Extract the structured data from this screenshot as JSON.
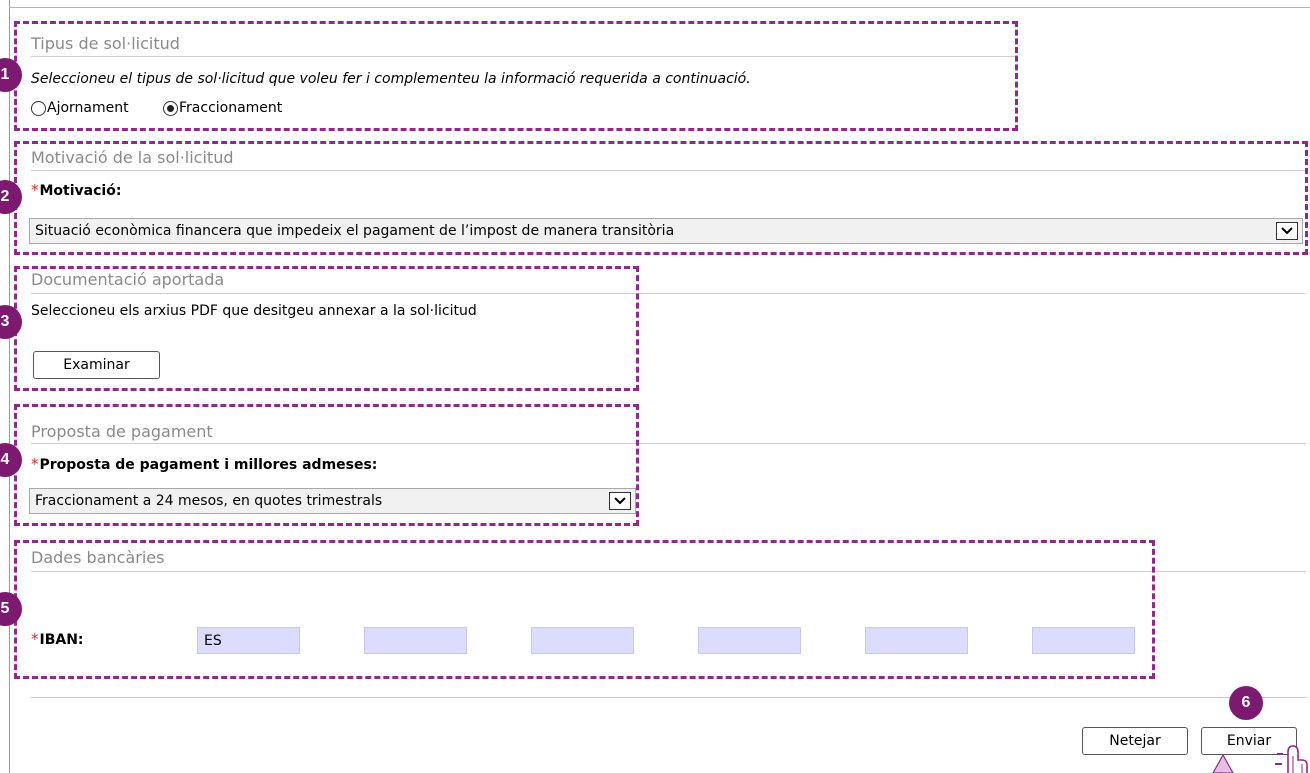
{
  "sections": {
    "request_type": {
      "step": "1",
      "legend": "Tipus de sol·licitud",
      "instruction": "Seleccioneu el tipus de sol·licitud que voleu fer i complementeu la informació requerida a continuació.",
      "options": [
        {
          "label": "Ajornament",
          "selected": false
        },
        {
          "label": "Fraccionament",
          "selected": true
        }
      ]
    },
    "motivation": {
      "step": "2",
      "legend": "Motivació de la sol·licitud",
      "required_mark": "*",
      "label": "Motivació:",
      "selected_value": "Situació econòmica financera que impedeix el pagament de l’impost de manera transitòria"
    },
    "documents": {
      "step": "3",
      "legend": "Documentació aportada",
      "instruction": "Seleccioneu els arxius PDF que desitgeu annexar a la sol·licitud",
      "browse_label": "Examinar"
    },
    "payment_proposal": {
      "step": "4",
      "legend": "Proposta de pagament",
      "required_mark": "*",
      "label": "Proposta de pagament i millores admeses:",
      "selected_value": "Fraccionament a 24 mesos, en quotes trimestrals"
    },
    "bank": {
      "step": "5",
      "legend": "Dades bancàries",
      "required_mark": "*",
      "label": "IBAN:",
      "iban_fields": [
        "ES",
        "",
        "",
        "",
        "",
        ""
      ]
    }
  },
  "actions": {
    "step": "6",
    "clear_label": "Netejar",
    "submit_label": "Enviar"
  },
  "colors": {
    "annotation": "#8e2a8a",
    "badge": "#7b1a6e",
    "iban_field_bg": "#dcdcff",
    "required": "#d0312d"
  }
}
